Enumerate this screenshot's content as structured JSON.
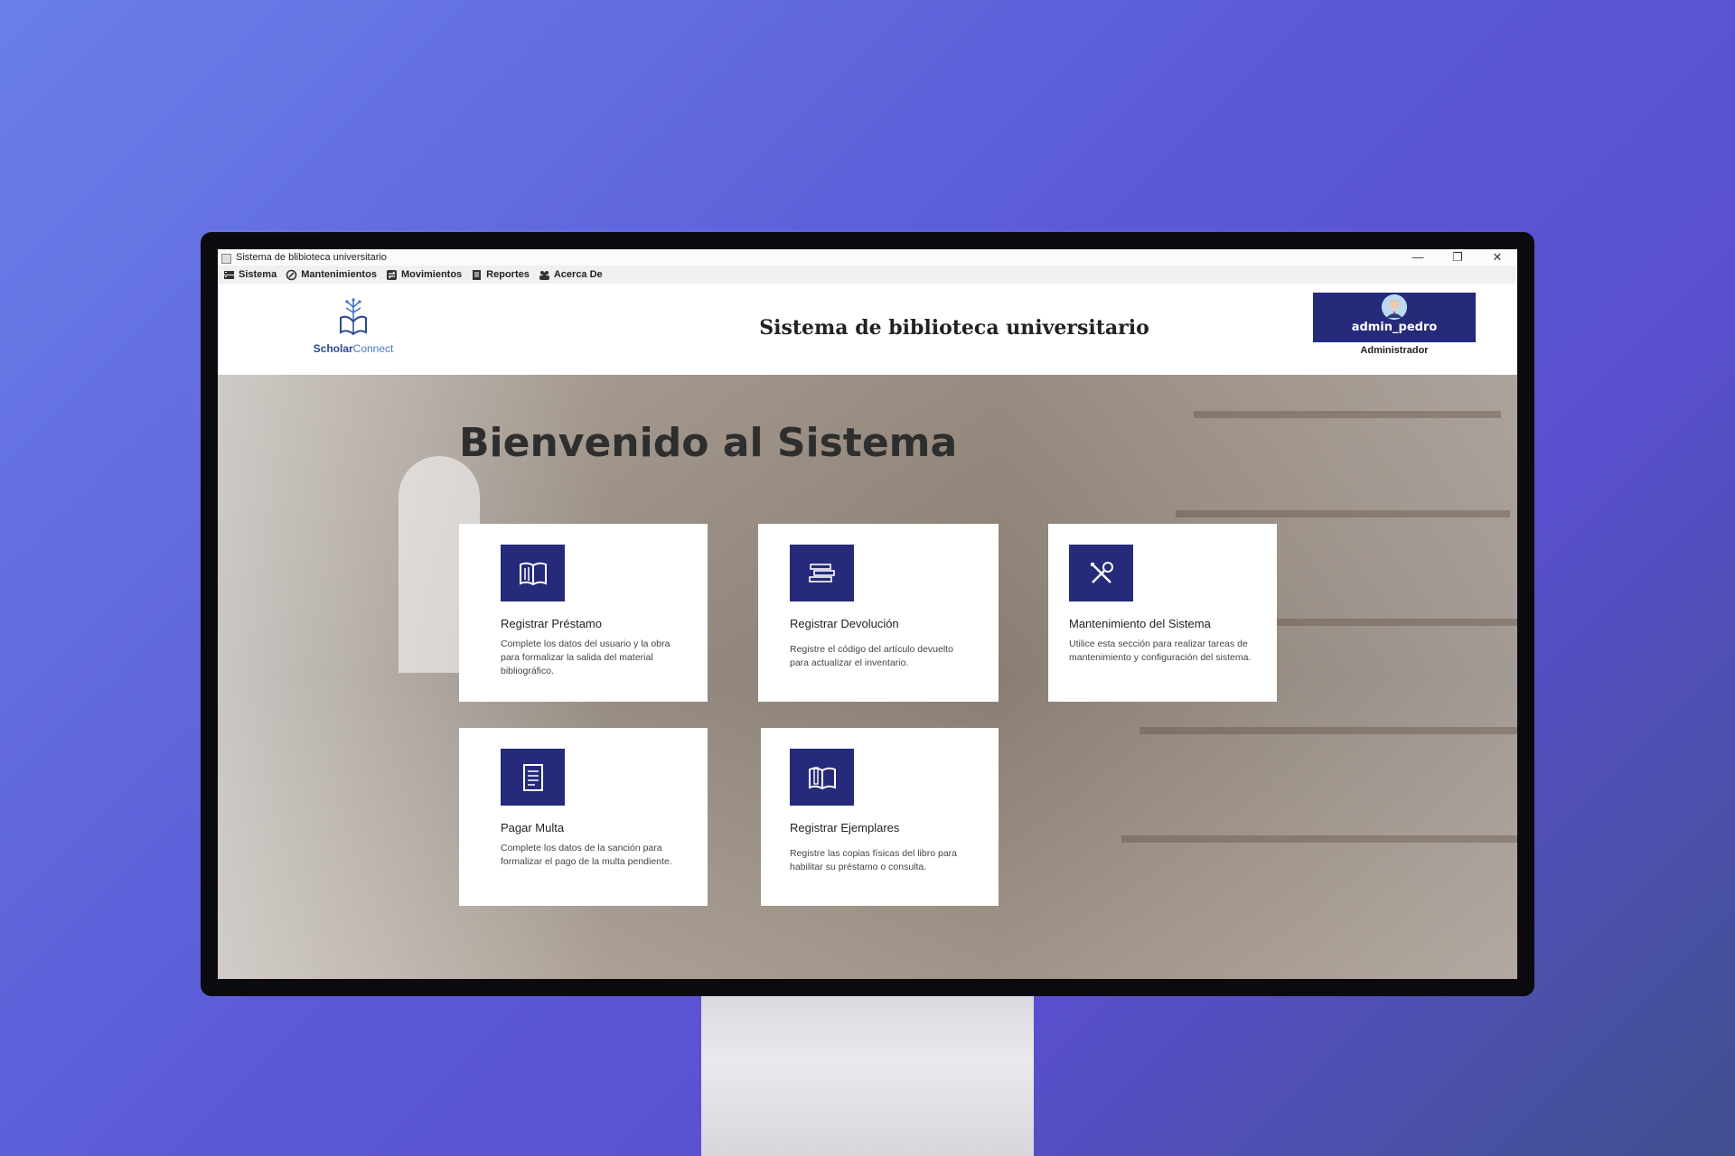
{
  "window": {
    "title": "Sistema de blibioteca universitario",
    "minimize": "—",
    "restore": "❐",
    "close": "✕"
  },
  "menu": [
    {
      "label": "Sistema",
      "icon": "server-icon"
    },
    {
      "label": "Mantenimientos",
      "icon": "maintenance-icon"
    },
    {
      "label": "Movimientos",
      "icon": "exchange-icon"
    },
    {
      "label": "Reportes",
      "icon": "report-icon"
    },
    {
      "label": "Acerca De",
      "icon": "group-icon"
    }
  ],
  "header": {
    "logo_part1": "Scholar",
    "logo_part2": "Connect",
    "title": "Sistema de biblioteca universitario",
    "username": "admin_pedro",
    "role": "Administrador"
  },
  "main": {
    "welcome": "Bienvenido al Sistema",
    "cards": [
      {
        "title": "Registrar Préstamo",
        "desc": "Complete los datos del usuario y la obra para formalizar la salida del material bibliográfico.",
        "icon": "open-book-icon"
      },
      {
        "title": "Registrar Devolución",
        "desc": "Registre el código del artículo devuelto para actualizar el inventario.",
        "icon": "book-stack-icon"
      },
      {
        "title": "Mantenimiento del Sistema",
        "desc": "Utilice esta sección para realizar tareas de mantenimiento y configuración del sistema.",
        "icon": "tools-icon"
      },
      {
        "title": "Pagar Multa",
        "desc": "Complete los datos de la sanción para formalizar el pago de la multa pendiente.",
        "icon": "receipt-icon"
      },
      {
        "title": "Registrar Ejemplares",
        "desc": "Registre las copias físicas del libro para habilitar su préstamo o consulta.",
        "icon": "books-icon"
      }
    ]
  },
  "colors": {
    "accent": "#262a7b",
    "background_gradient_start": "#6b7eea",
    "background_gradient_end": "#40508e"
  }
}
